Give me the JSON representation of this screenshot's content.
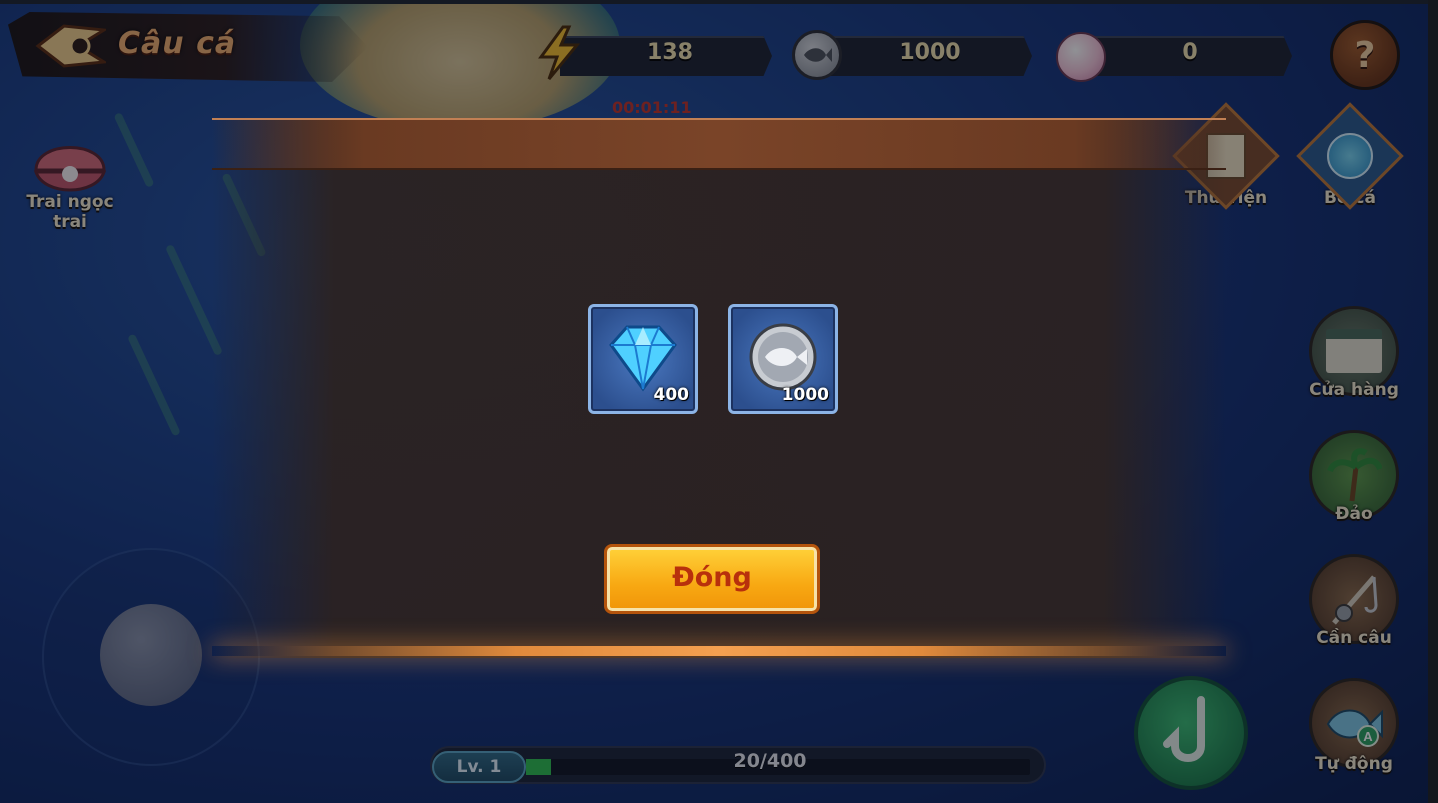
{
  "header": {
    "title": "Câu cá",
    "timer": "00:01:11"
  },
  "resources": {
    "energy": "138",
    "coins": "1000",
    "pearls": "0"
  },
  "left_menu": {
    "pearl_oyster_label": "Trai ngọc\ntrai"
  },
  "right_menu": {
    "library_label": "Thư viện",
    "aquarium_label": "Bể cá",
    "shop_label": "Cửa hàng",
    "island_label": "Đảo",
    "rod_label": "Cần câu",
    "auto_label": "Tự động"
  },
  "level": {
    "label": "Lv. 1",
    "progress_text": "20/400",
    "progress": 0.05
  },
  "reward_dialog": {
    "rewards": [
      {
        "icon": "diamond-icon",
        "count": "400"
      },
      {
        "icon": "fish-coin-icon",
        "count": "1000"
      }
    ],
    "close_label": "Đóng"
  },
  "colors": {
    "accent_gold": "#f8a812",
    "close_text": "#b8300c",
    "progress_green": "#2fc050"
  }
}
